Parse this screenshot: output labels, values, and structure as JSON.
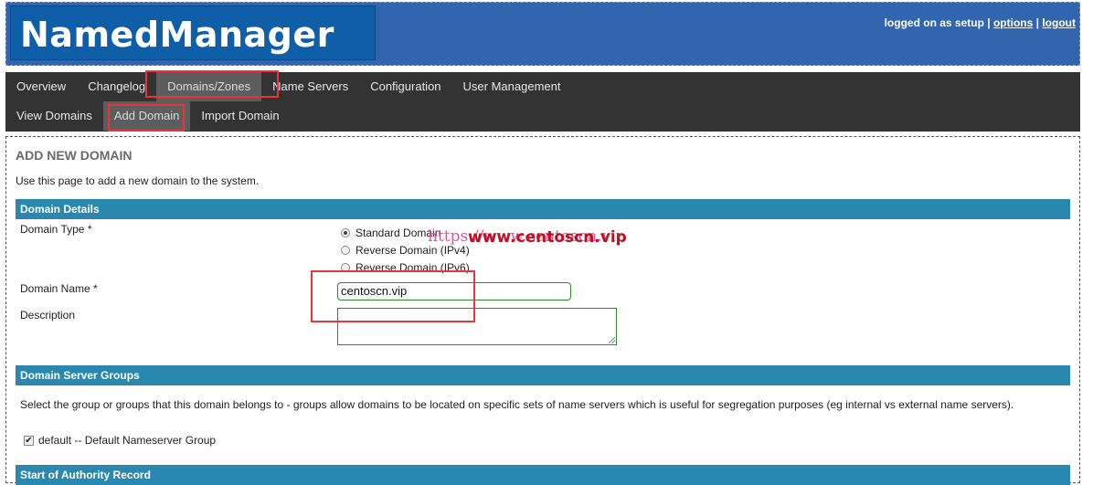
{
  "header": {
    "app_title": "NamedManager",
    "logged_on_text": "logged on as setup",
    "separator": "|",
    "options_link": "options",
    "logout_link": "logout"
  },
  "nav": {
    "top_items": [
      {
        "label": "Overview",
        "active": false
      },
      {
        "label": "Changelog",
        "active": false
      },
      {
        "label": "Domains/Zones",
        "active": true
      },
      {
        "label": "Name Servers",
        "active": false
      },
      {
        "label": "Configuration",
        "active": false
      },
      {
        "label": "User Management",
        "active": false
      }
    ],
    "sub_items": [
      {
        "label": "View Domains",
        "active": false
      },
      {
        "label": "Add Domain",
        "active": true
      },
      {
        "label": "Import Domain",
        "active": false
      }
    ]
  },
  "page": {
    "title": "ADD NEW DOMAIN",
    "description": "Use this page to add a new domain to the system."
  },
  "domain_details": {
    "section_title": "Domain Details",
    "domain_type_label": "Domain Type *",
    "domain_type_options": [
      {
        "label": "Standard Domain",
        "checked": true
      },
      {
        "label": "Reverse Domain (IPv4)",
        "checked": false
      },
      {
        "label": "Reverse Domain (IPv6)",
        "checked": false
      }
    ],
    "domain_name_label": "Domain Name *",
    "domain_name_value": "centoscn.vip",
    "description_label": "Description",
    "description_value": ""
  },
  "server_groups": {
    "section_title": "Domain Server Groups",
    "description": "Select the group or groups that this domain belongs to - groups allow domains to be located on specific sets of name servers which is useful for segregation purposes (eg internal vs external name servers).",
    "groups": [
      {
        "label": "default -- Default Nameserver Group",
        "checked": true
      }
    ]
  },
  "soa": {
    "section_title": "Start of Authority Record"
  },
  "watermark": {
    "text1": "https://www.centoscn.vip",
    "text2": "www.centoscn.vip"
  },
  "colors": {
    "header_bg": "#3265ad",
    "logo_bg": "#0f5fa8",
    "nav_bg": "#333333",
    "section_bar": "#2a88b0",
    "highlight": "#e8343a"
  }
}
